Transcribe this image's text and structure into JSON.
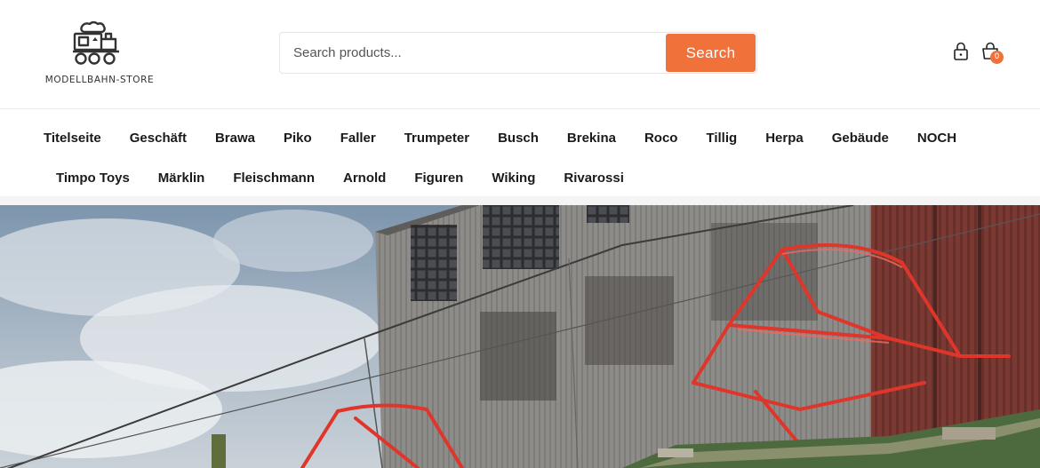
{
  "header": {
    "logo_text": "MODELLBAHN-STORE",
    "logo_icon": "steam-locomotive-icon",
    "search": {
      "placeholder": "Search products...",
      "value": "",
      "button_label": "Search"
    },
    "account_icon": "lock-icon",
    "cart_icon": "shopping-bag-icon",
    "cart_count": "0"
  },
  "nav": {
    "row1": [
      "Titelseite",
      "Geschäft",
      "Brawa",
      "Piko",
      "Faller",
      "Trumpeter",
      "Busch",
      "Brekina",
      "Roco",
      "Tillig",
      "Herpa",
      "Gebäude",
      "NOCH"
    ],
    "row2": [
      "Timpo Toys",
      "Märklin",
      "Fleischmann",
      "Arnold",
      "Figuren",
      "Wiking",
      "Rivarossi"
    ]
  },
  "colors": {
    "accent": "#f0713a",
    "text": "#1a1a1a",
    "pantograph": "#e0352a"
  },
  "hero": {
    "image": "model-railway-pantograph-industrial-building-photo"
  }
}
